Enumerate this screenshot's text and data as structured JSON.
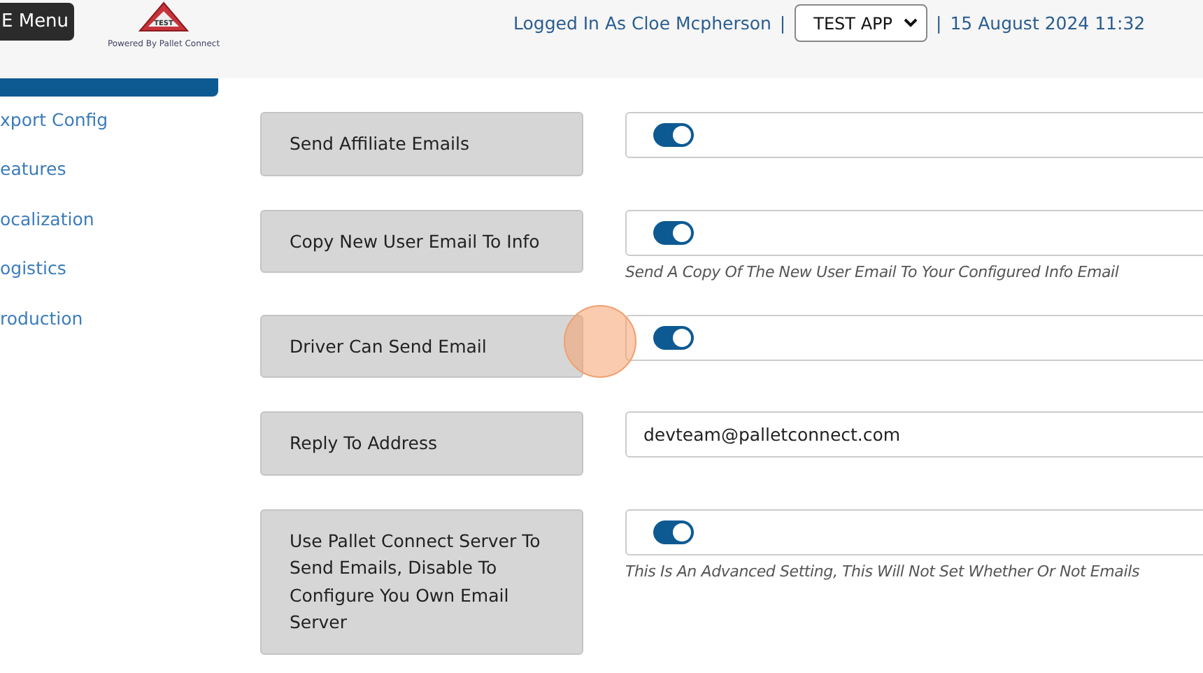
{
  "header": {
    "menu_button": "E Menu",
    "logo": {
      "badge": "TEST",
      "caption": "Powered By Pallet Connect"
    },
    "user": "Logged In As Cloe Mcpherson",
    "separator_1": "|",
    "app_select": "TEST APP",
    "separator_2": "|",
    "datetime": "15 August 2024 11:32"
  },
  "sidebar": {
    "items": [
      {
        "selected": true
      },
      {
        "label": "xport Config",
        "selected": false
      },
      {
        "label": "eatures",
        "selected": false
      },
      {
        "label": "ocalization",
        "selected": false
      },
      {
        "label": "ogistics",
        "selected": false
      },
      {
        "label": "roduction",
        "selected": false
      }
    ]
  },
  "settings": [
    {
      "label": "Send Affiliate Emails",
      "kind": "toggle",
      "on": true
    },
    {
      "label": "Copy New User Email To Info",
      "kind": "toggle",
      "on": true,
      "help": "Send A Copy Of The New User Email To Your Configured Info Email"
    },
    {
      "label": "Driver Can Send Email",
      "kind": "toggle",
      "on": true
    },
    {
      "label": "Reply To Address",
      "kind": "text",
      "value": "devteam@palletconnect.com"
    },
    {
      "label": "Use Pallet Connect Server To Send Emails, Disable To Configure You Own Email Server",
      "kind": "toggle",
      "on": true,
      "help": "This Is An Advanced Setting, This Will Not Set Whether Or Not Emails"
    }
  ]
}
